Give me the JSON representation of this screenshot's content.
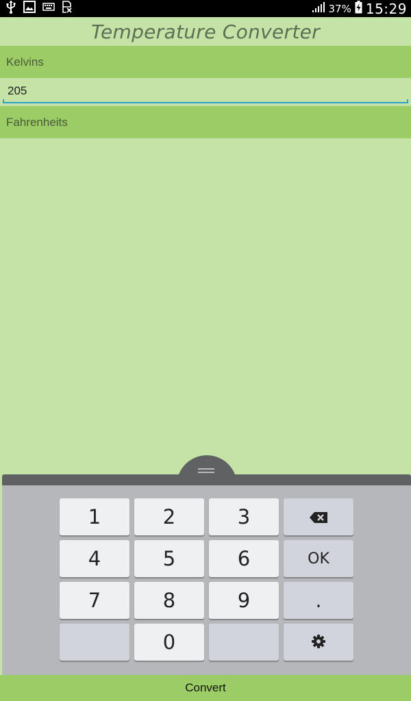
{
  "status_bar": {
    "battery_percent": "37%",
    "time": "15:29",
    "left_icons": [
      "usb-icon",
      "image-icon",
      "keyboard-icon",
      "sim-missing-icon"
    ],
    "right_icons": [
      "signal-icon",
      "battery-charging-icon"
    ]
  },
  "app": {
    "title": "Temperature Converter"
  },
  "kelvins": {
    "label": "Kelvins",
    "value": "205"
  },
  "fahrenheits": {
    "label": "Fahrenheits"
  },
  "keyboard": {
    "keys": {
      "k1": "1",
      "k2": "2",
      "k3": "3",
      "k4": "4",
      "k5": "5",
      "k6": "6",
      "k7": "7",
      "k8": "8",
      "k9": "9",
      "k0": "0",
      "ok": "OK",
      "dot": "."
    },
    "icons": [
      "backspace-icon",
      "settings-icon",
      "handle-icon"
    ]
  },
  "convert_button": {
    "label": "Convert"
  },
  "colors": {
    "background": "#c5e3a6",
    "section_bar": "#9ccc65",
    "input_underline": "#2aa3c9",
    "keyboard_bg": "#b5b7ba",
    "key_bg": "#eef0f2",
    "func_key_bg": "#d2d4dd"
  }
}
